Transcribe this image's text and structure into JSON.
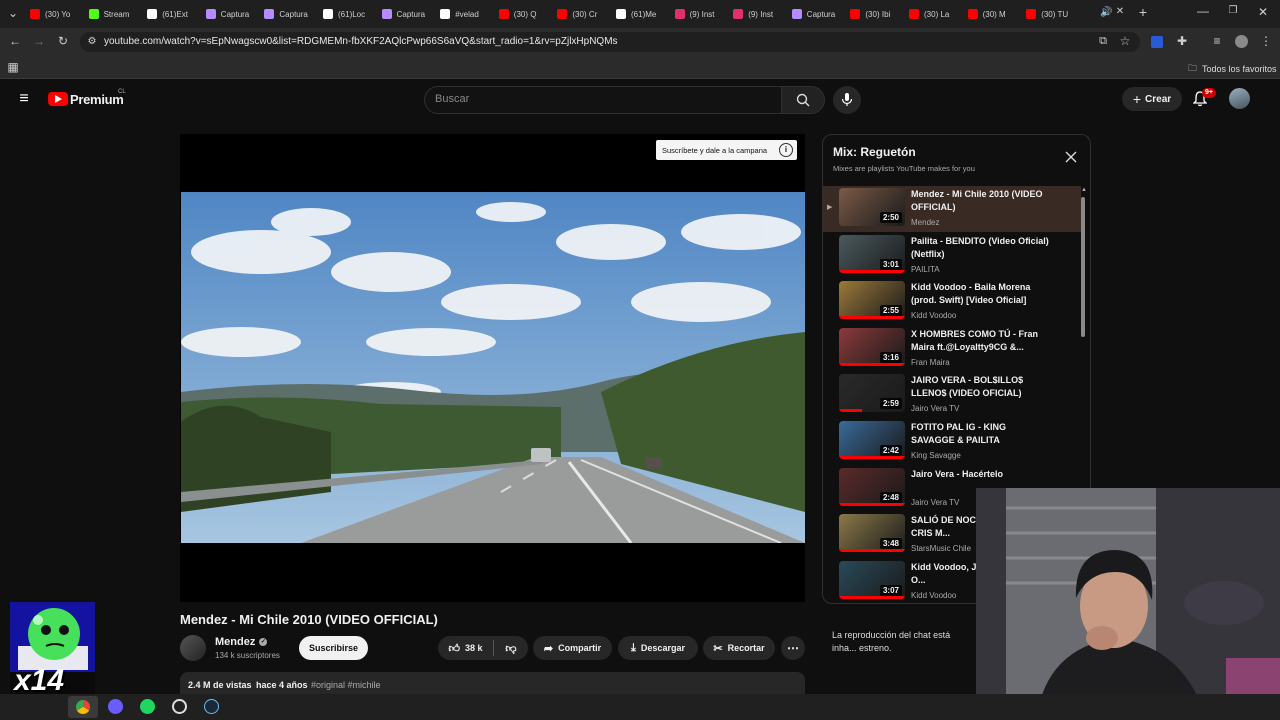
{
  "browser": {
    "tabs": [
      {
        "label": "(30) Yo",
        "icon": "youtube-icon",
        "color": "#ff0000"
      },
      {
        "label": "Stream",
        "icon": "kick-icon",
        "color": "#53fc18"
      },
      {
        "label": "(61)Ext",
        "icon": "tiktok-icon",
        "color": "#ffffff"
      },
      {
        "label": "Captura",
        "icon": "pen-icon",
        "color": "#b48cff"
      },
      {
        "label": "Captura",
        "icon": "pen-icon",
        "color": "#b48cff"
      },
      {
        "label": "(61)Loc",
        "icon": "tiktok-icon",
        "color": "#ffffff"
      },
      {
        "label": "Captura",
        "icon": "pen-icon",
        "color": "#b48cff"
      },
      {
        "label": "#velad",
        "icon": "tiktok-icon",
        "color": "#ffffff"
      },
      {
        "label": "(30) Q",
        "icon": "youtube-icon",
        "color": "#ff0000"
      },
      {
        "label": "(30) Cr",
        "icon": "youtube-icon",
        "color": "#ff0000"
      },
      {
        "label": "(61)Me",
        "icon": "tiktok-icon",
        "color": "#ffffff"
      },
      {
        "label": "(9) Inst",
        "icon": "instagram-icon",
        "color": "#e1306c"
      },
      {
        "label": "(9) Inst",
        "icon": "instagram-icon",
        "color": "#e1306c"
      },
      {
        "label": "Captura",
        "icon": "pen-icon",
        "color": "#b48cff"
      },
      {
        "label": "(30) Ibi",
        "icon": "youtube-icon",
        "color": "#ff0000"
      },
      {
        "label": "(30) La",
        "icon": "youtube-icon",
        "color": "#ff0000"
      },
      {
        "label": "(30) M",
        "icon": "youtube-icon",
        "color": "#ff0000"
      },
      {
        "label": "(30) TU",
        "icon": "youtube-icon",
        "color": "#ff0000"
      }
    ],
    "url": "youtube.com/watch?v=sEpNwagscw0&list=RDGMEMn-fbXKF2AQlcPwp66S6aVQ&start_radio=1&rv=pZjlxHpNQMs",
    "bookmarks_label": "Todos los favoritos"
  },
  "youtube": {
    "logo_text": "Premium",
    "region": "CL",
    "search_placeholder": "Buscar",
    "create_label": "Crear",
    "notifications": "9+",
    "overlay_label": "Suscríbete y dale a la campana",
    "video": {
      "title": "Mendez - Mi Chile 2010 (VIDEO OFFICIAL)",
      "channel": "Mendez",
      "subscribers": "134 k suscriptores",
      "subscribe_label": "Suscribirse",
      "likes": "38 k",
      "share_label": "Compartir",
      "download_label": "Descargar",
      "clip_label": "Recortar",
      "views": "2.4 M de vistas",
      "age": "hace 4 años",
      "tags": "#original #michile"
    },
    "playlist": {
      "title": "Mix: Reguetón",
      "subtitle": "Mixes are playlists YouTube makes for you",
      "items": [
        {
          "title": "Mendez - Mi Chile 2010 (VIDEO OFFICIAL)",
          "channel": "Mendez",
          "duration": "2:50",
          "progress": 0.0,
          "color": "#7a5a48"
        },
        {
          "title": "Pailita - BENDITO (Video Oficial) (Netflix)",
          "channel": "PAILITA",
          "duration": "3:01",
          "progress": 1.0,
          "color": "#4a5a5e"
        },
        {
          "title": "Kidd Voodoo - Baila Morena (prod. Swift) [Video Oficial]",
          "channel": "Kidd Voodoo",
          "duration": "2:55",
          "progress": 1.0,
          "color": "#9a7a3a"
        },
        {
          "title": "X HOMBRES COMO TÚ - Fran Maira ft.@Loyaltty9CG &...",
          "channel": "Fran Maira",
          "duration": "3:16",
          "progress": 1.0,
          "color": "#8a3a3a"
        },
        {
          "title": "JAIRO VERA - BOL$ILLO$ LLENO$ (VIDEO OFICIAL)",
          "channel": "Jairo Vera TV",
          "duration": "2:59",
          "progress": 0.35,
          "color": "#2a2a2a"
        },
        {
          "title": "FOTITO PAL IG - KING SAVAGGE & PAILITA",
          "channel": "King Savagge",
          "duration": "2:42",
          "progress": 1.0,
          "color": "#3a6a9a"
        },
        {
          "title": "Jairo Vera - Hacértelo",
          "channel": "Jairo Vera TV",
          "duration": "2:48",
          "progress": 1.0,
          "color": "#5a2a2a"
        },
        {
          "title": "SALIÓ DE NOCH... Oficial) - CRIS M...",
          "channel": "StarsMusic Chile",
          "duration": "3:48",
          "progress": 1.0,
          "color": "#8a7a4a"
        },
        {
          "title": "Kidd Voodoo, JC... Mareo (Video O...",
          "channel": "Kidd Voodoo",
          "duration": "3:07",
          "progress": 1.0,
          "color": "#2a4a5a"
        }
      ]
    },
    "chat_notice": "La reproducción del chat está inha... estreno."
  },
  "overlay": {
    "counter": "x14"
  }
}
